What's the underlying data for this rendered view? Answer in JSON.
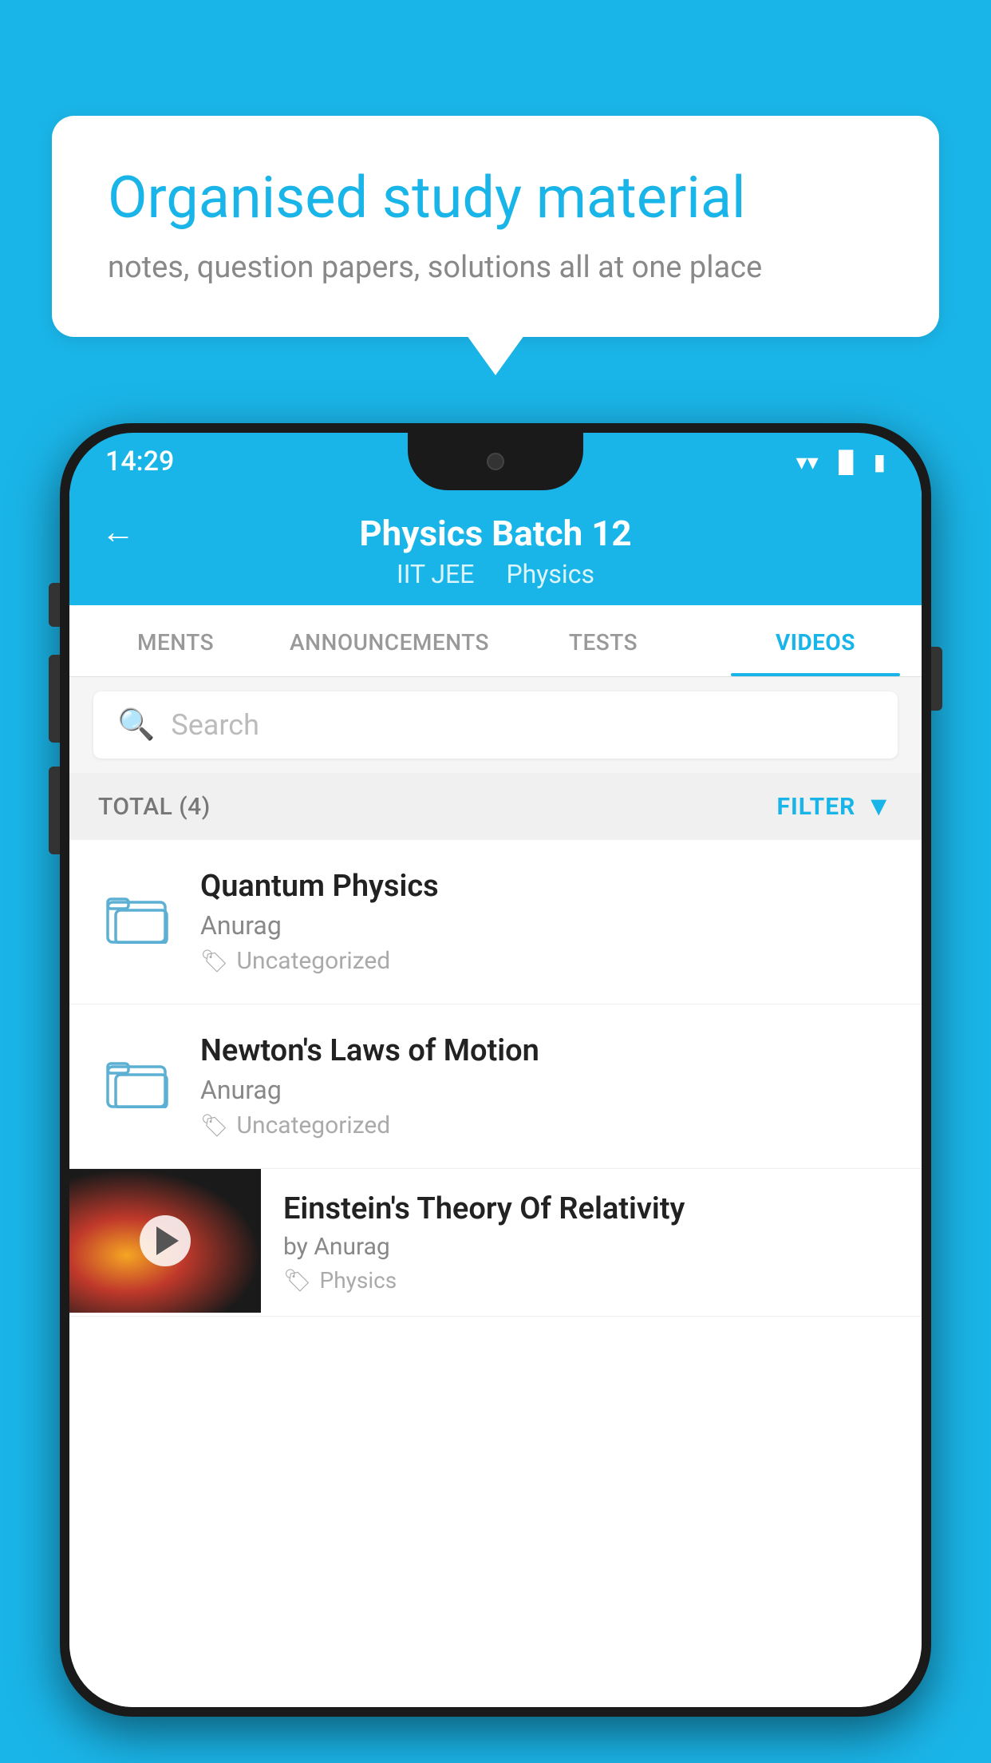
{
  "background_color": "#1ab5e8",
  "bubble": {
    "title": "Organised study material",
    "subtitle": "notes, question papers, solutions all at one place"
  },
  "phone": {
    "status_bar": {
      "time": "14:29"
    },
    "header": {
      "back_label": "←",
      "title": "Physics Batch 12",
      "breadcrumb_1": "IIT JEE",
      "breadcrumb_2": "Physics"
    },
    "tabs": [
      {
        "label": "MENTS",
        "active": false
      },
      {
        "label": "ANNOUNCEMENTS",
        "active": false
      },
      {
        "label": "TESTS",
        "active": false
      },
      {
        "label": "VIDEOS",
        "active": true
      }
    ],
    "search": {
      "placeholder": "Search"
    },
    "filter_row": {
      "total": "TOTAL (4)",
      "filter_label": "FILTER"
    },
    "items": [
      {
        "title": "Quantum Physics",
        "author": "Anurag",
        "tag": "Uncategorized",
        "has_thumb": false
      },
      {
        "title": "Newton's Laws of Motion",
        "author": "Anurag",
        "tag": "Uncategorized",
        "has_thumb": false
      },
      {
        "title": "Einstein's Theory Of Relativity",
        "author": "by Anurag",
        "tag": "Physics",
        "has_thumb": true
      }
    ]
  }
}
